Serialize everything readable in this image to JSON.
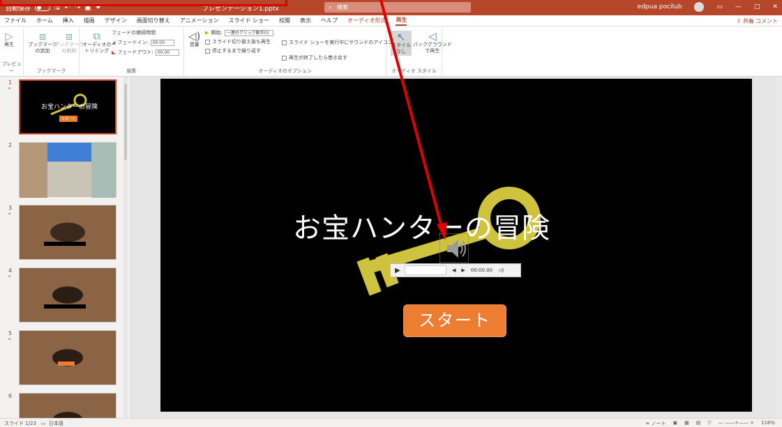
{
  "titlebar": {
    "autosave": "自動保存",
    "autosave_state": "オフ",
    "doc_title": "プレゼンテーション1.pptx",
    "search_placeholder": "検索",
    "user": "edpua pocilub",
    "window_controls": [
      "—",
      "□",
      "✕"
    ]
  },
  "tabs": [
    {
      "label": "ファイル"
    },
    {
      "label": "ホーム"
    },
    {
      "label": "挿入"
    },
    {
      "label": "描画"
    },
    {
      "label": "デザイン"
    },
    {
      "label": "画面切り替え"
    },
    {
      "label": "アニメーション"
    },
    {
      "label": "スライド ショー"
    },
    {
      "label": "校閲"
    },
    {
      "label": "表示"
    },
    {
      "label": "ヘルプ"
    },
    {
      "label": "オーディオ形式"
    },
    {
      "label": "再生"
    }
  ],
  "share_label": "共有",
  "comment_label": "コメント",
  "ribbon": {
    "preview": {
      "play": "再生",
      "group": "プレビュー"
    },
    "bookmark": {
      "add": "ブックマーク\nの追加",
      "remove": "ブックマーク\nの削除",
      "group": "ブックマーク"
    },
    "edit": {
      "trim": "オーディオの\nトリミング",
      "fade_title": "フェードの継続時間",
      "fade_in": "フェードイン:",
      "fade_in_val": "00.00",
      "fade_out": "フェードアウト:",
      "fade_out_val": "00.00",
      "group": "編集"
    },
    "options": {
      "volume": "音量",
      "start_label": "開始:",
      "start_value": "一連のクリック動作(I)",
      "across_slides": "スライド切り替え後も再生",
      "loop": "停止するまで繰り返す",
      "hide": "スライド ショーを実行中にサウンドのアイコンを隠す",
      "rewind": "再生が終了したら巻き戻す",
      "group": "オーディオのオプション"
    },
    "style": {
      "none": "スタイル\nなし",
      "bg": "バックグラウンド\nで再生",
      "group": "オーディオ スタイル"
    }
  },
  "thumbnails": [
    {
      "num": "1",
      "title": "お宝ハンターの冒険",
      "btn": "スタート"
    },
    {
      "num": "2"
    },
    {
      "num": "3"
    },
    {
      "num": "4"
    },
    {
      "num": "5"
    },
    {
      "num": "6"
    }
  ],
  "slide": {
    "title": "お宝ハンターの冒険",
    "start_button": "スタート",
    "player_time": "00:00.00"
  },
  "status": {
    "slide_info": "スライド 1/23",
    "lang": "日本語",
    "notes": "ノート",
    "zoom": "116%"
  },
  "colors": {
    "accent": "#b7472a",
    "key": "#cfc23c",
    "button": "#ed7d31",
    "annotation": "#e00000"
  }
}
